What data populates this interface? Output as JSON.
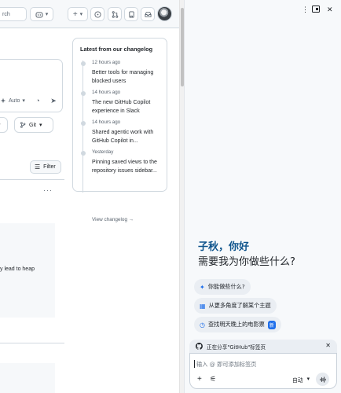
{
  "header": {
    "search_text": "rch",
    "copilot_icon": "copilot-icon",
    "plus_label": "+",
    "chevron": "▾"
  },
  "composer": {
    "mode_label": "Auto",
    "git_label": "Git"
  },
  "feed": {
    "filter_label": "Filter",
    "kebab": "···",
    "snippet": "y lead to heap"
  },
  "changelog": {
    "title": "Latest from our changelog",
    "items": [
      {
        "time": "12 hours ago",
        "text": "Better tools for managing blocked users"
      },
      {
        "time": "14 hours ago",
        "text": "The new GitHub Copilot experience in Slack"
      },
      {
        "time": "14 hours ago",
        "text": "Shared agentic work with GitHub Copilot in..."
      },
      {
        "time": "Yesterday",
        "text": "Pinning saved views to the repository issues sidebar..."
      }
    ],
    "view_link": "View changelog →"
  },
  "copilot": {
    "greeting_name": "子秋，你好",
    "greeting_question": "需要我为你做些什么?",
    "suggestions": [
      {
        "icon": "sparkle-icon",
        "label": "你能做些什么?"
      },
      {
        "icon": "lightbulb-icon",
        "label": "从更多角度了解某个主题"
      },
      {
        "icon": "clock-icon",
        "label": "查找明天晚上的电影票",
        "badge": "新"
      }
    ],
    "share_text": "正在分享\"GitHub\"标签页",
    "input_placeholder": "输入 @ 即可添加标签页",
    "mode_label": "自动",
    "accent_color": "#1f6feb",
    "greeting_color": "#0f548c"
  }
}
